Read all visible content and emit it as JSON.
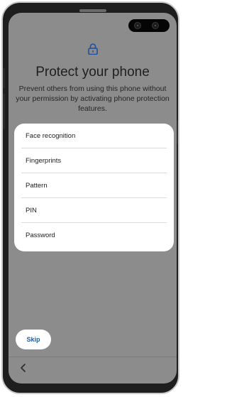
{
  "header": {
    "title": "Protect your phone",
    "description": "Prevent others from using this phone without your permission by activating phone protection features."
  },
  "options": [
    {
      "label": "Face recognition"
    },
    {
      "label": "Fingerprints"
    },
    {
      "label": "Pattern"
    },
    {
      "label": "PIN"
    },
    {
      "label": "Password"
    }
  ],
  "footer": {
    "skip_label": "Skip"
  },
  "icons": {
    "lock": "lock-icon",
    "back": "back-chevron-icon"
  },
  "colors": {
    "accent": "#1e5aa8",
    "screen_background": "#8c8c8c",
    "card": "#ffffff"
  }
}
